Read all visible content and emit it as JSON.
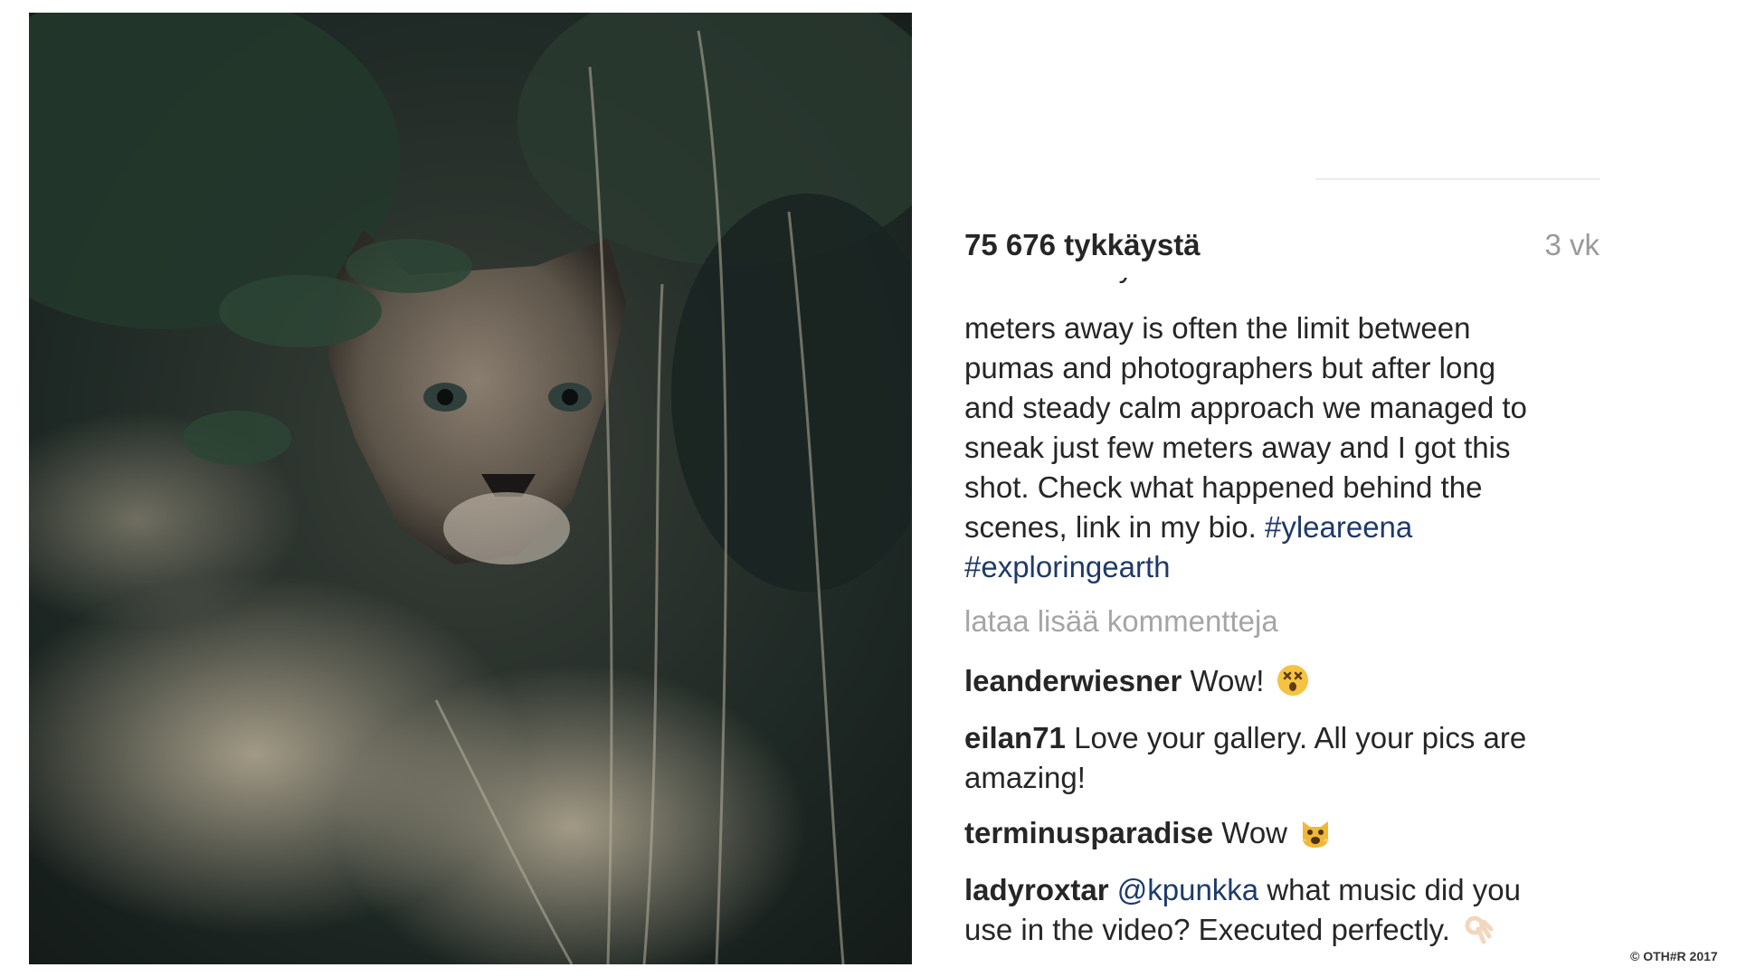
{
  "post": {
    "likes": "75 676 tykkäystä",
    "age": "3 vk",
    "caption_clipped": "meters away the limit between",
    "caption_lines": [
      "meters away is often the limit between",
      "pumas and photographers but after long",
      "and steady calm approach we managed to",
      "sneak just few meters away and I got this",
      "shot. Check what happened behind the"
    ],
    "caption_last_text": "scenes, link in my bio. ",
    "hashtags": [
      "#yleareena",
      "#exploringearth"
    ],
    "load_more": "lataa lisää kommentteja"
  },
  "comments": [
    {
      "user": "leanderwiesner",
      "text": "Wow!",
      "emoji": "astonished-face-emoji"
    },
    {
      "user": "eilan71",
      "text": "Love your gallery. All your pics are",
      "text2": "amazing!"
    },
    {
      "user": "terminusparadise",
      "text": "Wow",
      "emoji": "weary-cat-emoji"
    },
    {
      "user": "ladyroxtar",
      "mention": "@kpunkka",
      "text": " what music did you",
      "text2": "use in the video? Executed perfectly.",
      "emoji": "ok-hand-emoji"
    }
  ],
  "copyright": "© OTH#R 2017",
  "photo": {
    "subject": "puma-photo"
  }
}
